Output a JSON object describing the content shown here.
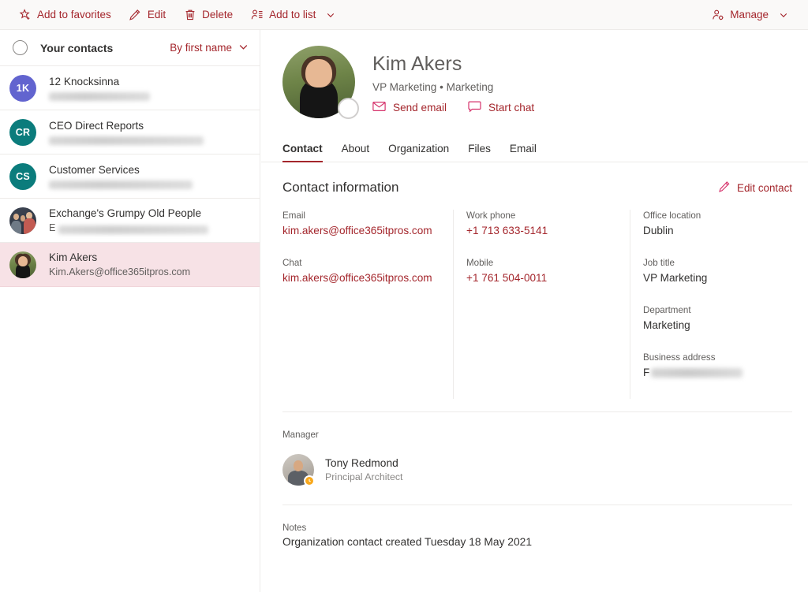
{
  "commandbar": {
    "actions": [
      {
        "label": "Add to favorites",
        "icon": "star-add-icon"
      },
      {
        "label": "Edit",
        "icon": "pencil-icon"
      },
      {
        "label": "Delete",
        "icon": "trash-icon"
      },
      {
        "label": "Add to list",
        "icon": "person-list-icon",
        "has_chevron": true
      }
    ],
    "manage": {
      "label": "Manage",
      "icon": "person-gear-icon",
      "has_chevron": true
    }
  },
  "list": {
    "select_all_icon": "circle-unchecked-icon",
    "title": "Your contacts",
    "sort": {
      "label": "By first name",
      "icon": "chevron-down-icon"
    },
    "items": [
      {
        "name": "12 Knocksinna",
        "sub": "",
        "sub_redacted": true,
        "avatar_type": "initials",
        "initials": "1K",
        "avatar_color": "#6264cf",
        "selected": false
      },
      {
        "name": "CEO Direct Reports",
        "sub": "",
        "sub_redacted": true,
        "avatar_type": "initials",
        "initials": "CR",
        "avatar_color": "#0b7c7c",
        "selected": false
      },
      {
        "name": "Customer Services",
        "sub": "",
        "sub_redacted": true,
        "avatar_type": "initials",
        "initials": "CS",
        "avatar_color": "#0b7c7c",
        "selected": false
      },
      {
        "name": "Exchange's Grumpy Old People",
        "sub": "E",
        "sub_redacted": true,
        "avatar_type": "photo-group",
        "initials": "",
        "avatar_color": "#3d4552",
        "selected": false
      },
      {
        "name": "Kim Akers",
        "sub": "Kim.Akers@office365itpros.com",
        "sub_redacted": false,
        "avatar_type": "photo-kim",
        "initials": "",
        "avatar_color": "#6e8448",
        "selected": true
      }
    ]
  },
  "detail": {
    "persona": {
      "name": "Kim Akers",
      "role": "VP Marketing • Marketing",
      "presence": "available-empty",
      "actions": [
        {
          "label": "Send email",
          "icon": "mail-icon"
        },
        {
          "label": "Start chat",
          "icon": "chat-icon"
        }
      ]
    },
    "tabs": [
      {
        "label": "Contact",
        "active": true
      },
      {
        "label": "About",
        "active": false
      },
      {
        "label": "Organization",
        "active": false
      },
      {
        "label": "Files",
        "active": false
      },
      {
        "label": "Email",
        "active": false
      }
    ],
    "contact_information": {
      "title": "Contact information",
      "edit": {
        "label": "Edit contact",
        "icon": "pencil-icon"
      },
      "columns": [
        {
          "fields": [
            {
              "label": "Email",
              "value": "kim.akers@office365itpros.com",
              "style": "link",
              "redacted": false
            },
            {
              "label": "Chat",
              "value": "kim.akers@office365itpros.com",
              "style": "link",
              "redacted": false
            }
          ]
        },
        {
          "fields": [
            {
              "label": "Work phone",
              "value": "+1 713 633-5141",
              "style": "link",
              "redacted": false
            },
            {
              "label": "Mobile",
              "value": "+1 761 504-0011",
              "style": "link",
              "redacted": false
            }
          ]
        },
        {
          "fields": [
            {
              "label": "Office location",
              "value": "Dublin",
              "style": "plain",
              "redacted": false
            },
            {
              "label": "Job title",
              "value": "VP Marketing",
              "style": "plain",
              "redacted": false
            },
            {
              "label": "Department",
              "value": "Marketing",
              "style": "plain",
              "redacted": false
            },
            {
              "label": "Business address",
              "value": "F",
              "style": "plain",
              "redacted": true
            }
          ]
        }
      ]
    },
    "manager": {
      "label": "Manager",
      "name": "Tony Redmond",
      "title": "Principal Architect",
      "presence": "away"
    },
    "notes": {
      "label": "Notes",
      "value": "Organization contact created Tuesday 18 May 2021"
    }
  },
  "colors": {
    "accent": "#a4262c",
    "selected_row": "#f7e2e6",
    "border": "#edebe9",
    "text_primary": "#323130",
    "text_secondary": "#605e5c",
    "presence_away": "#f8a81c"
  }
}
